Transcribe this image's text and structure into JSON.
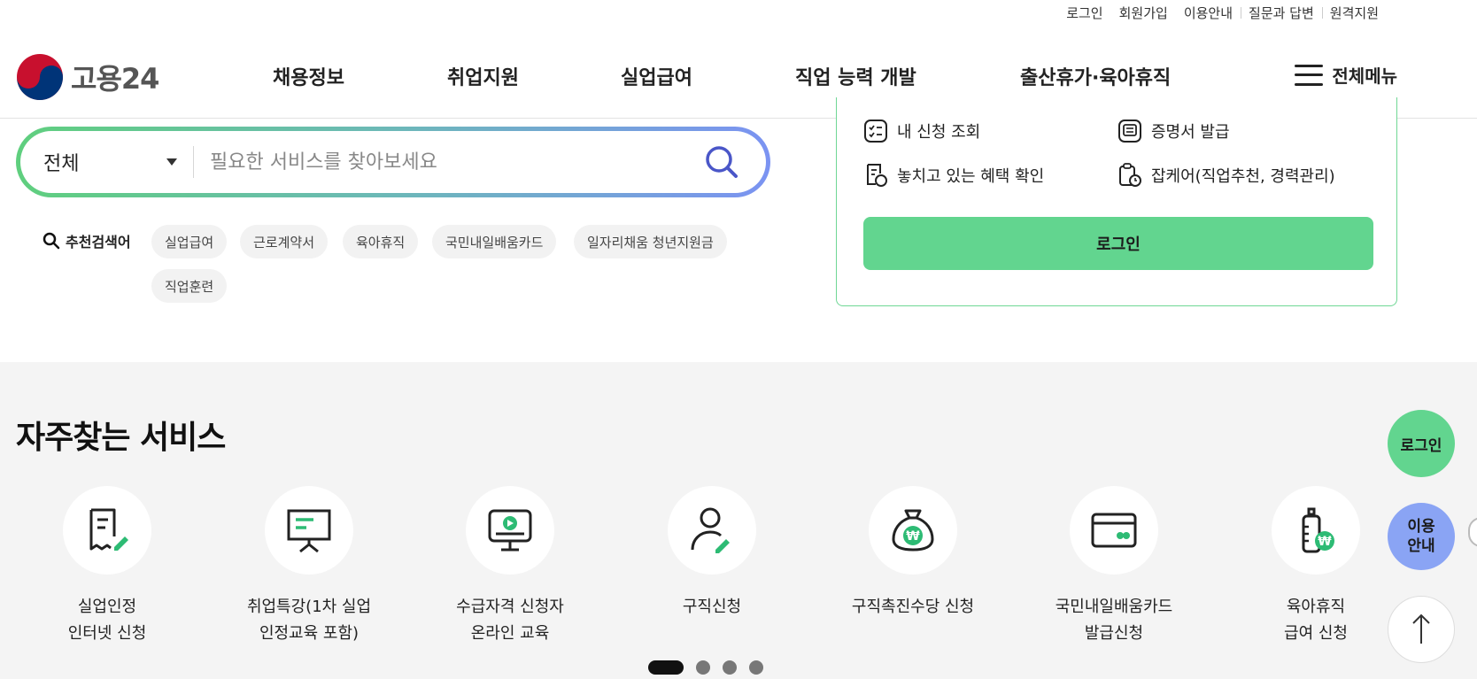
{
  "utility_nav": [
    "로그인",
    "회원가입",
    "이용안내",
    "질문과 답변",
    "원격지원"
  ],
  "logo": {
    "text": "고용24"
  },
  "gnb": [
    "채용정보",
    "취업지원",
    "실업급여",
    "직업 능력 개발",
    "출산휴가·육아휴직"
  ],
  "all_menu_label": "전체메뉴",
  "search": {
    "category": "전체",
    "placeholder": "필요한 서비스를 찾아보세요"
  },
  "recommended": {
    "label": "추천검색어",
    "chips": [
      "실업급여",
      "근로계약서",
      "육아휴직",
      "국민내일배움카드",
      "일자리채움 청년지원금",
      "직업훈련"
    ]
  },
  "login_panel": {
    "items": [
      "내 신청 조회",
      "증명서 발급",
      "놓치고 있는 혜택 확인",
      "잡케어(직업추천, 경력관리)"
    ],
    "login_button": "로그인"
  },
  "frequent_services": {
    "title": "자주찾는 서비스",
    "items": [
      {
        "label": "실업인정\n인터넷 신청",
        "icon": "document-pen-icon"
      },
      {
        "label": "취업특강(1차 실업\n인정교육 포함)",
        "icon": "presentation-board-icon"
      },
      {
        "label": "수급자격 신청자\n온라인 교육",
        "icon": "monitor-play-icon"
      },
      {
        "label": "구직신청",
        "icon": "person-pen-icon"
      },
      {
        "label": "구직촉진수당 신청",
        "icon": "money-bag-icon"
      },
      {
        "label": "국민내일배움카드\n발급신청",
        "icon": "card-icon"
      },
      {
        "label": "육아휴직\n급여 신청",
        "icon": "baby-bottle-won-icon"
      }
    ],
    "pagination": {
      "pages": 4,
      "active": 1
    }
  },
  "floating": {
    "login": "로그인",
    "guide": "이용\n안내"
  },
  "colors": {
    "green": "#62d58f",
    "blue": "#8aa4f4",
    "band": "#f4f4f4"
  }
}
